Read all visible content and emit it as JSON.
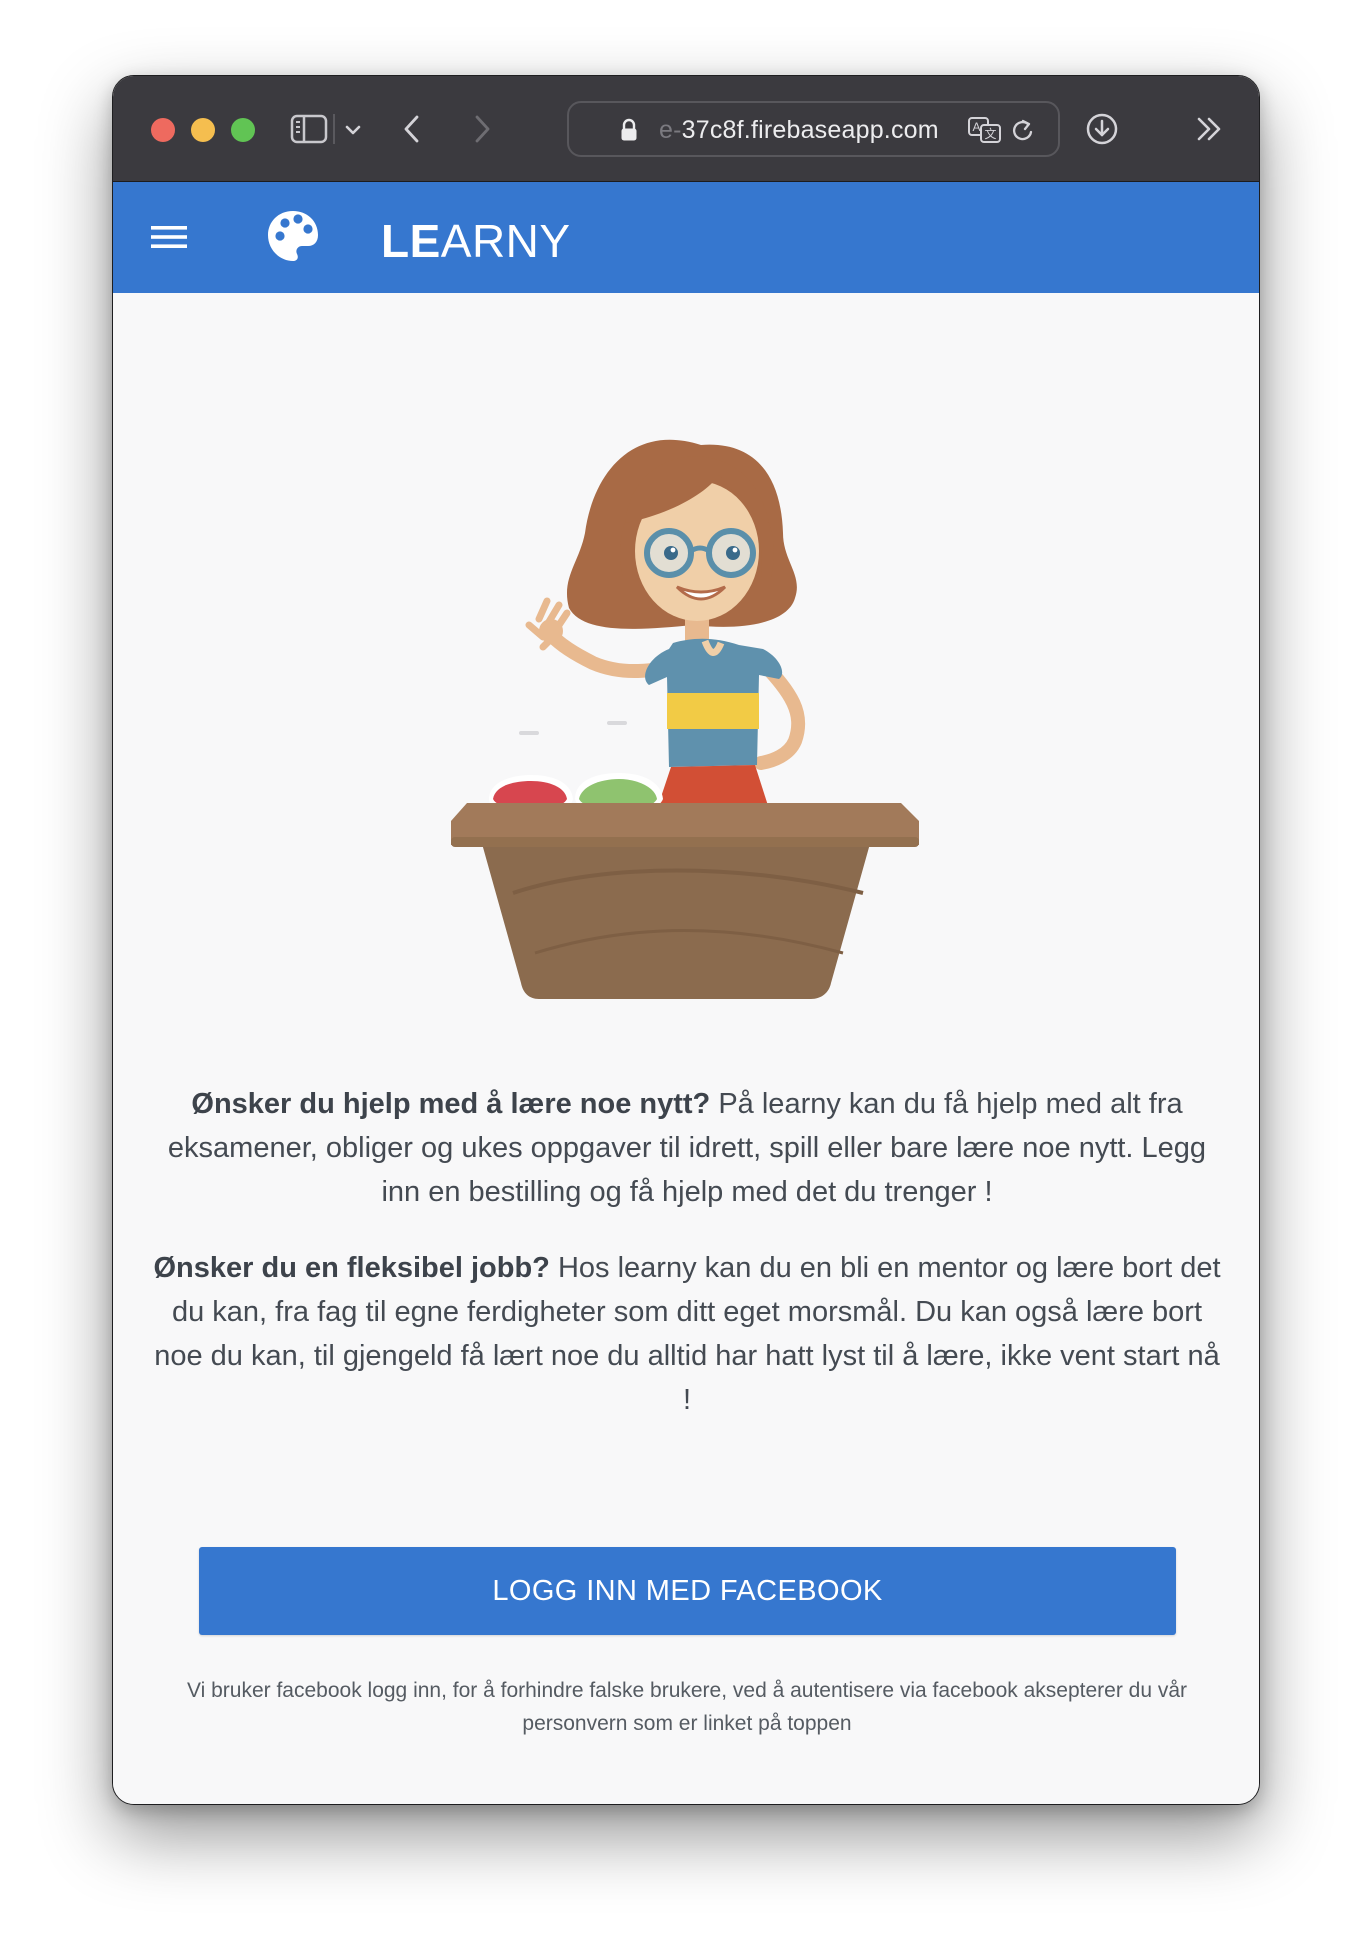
{
  "browser": {
    "url_prefix_faded": "e-",
    "url_domain": "37c8f.firebaseapp.com",
    "icons": [
      "sidebar-icon",
      "chevron-down-icon",
      "back-icon",
      "forward-icon",
      "lock-icon",
      "translate-icon",
      "reload-icon",
      "download-icon",
      "more-icon"
    ]
  },
  "app": {
    "brand_bold": "LE",
    "brand_rest": "ARNY",
    "brand_icon": "palette-icon",
    "menu_icon": "hamburger-icon",
    "header_color": "#3677cf"
  },
  "content": {
    "intro1_bold": "Ønsker du hjelp med å lære noe nytt?",
    "intro1_text": " På learny kan du få hjelp med alt fra eksamener, obliger og ukes oppgaver til idrett, spill eller bare lære noe nytt. Legg inn en bestilling og få hjelp med det du trenger !",
    "intro2_bold": "Ønsker du en fleksibel jobb?",
    "intro2_text": " Hos learny kan du en bli en mentor og lære bort det du kan, fra fag til egne ferdigheter som ditt eget morsmål. Du kan også lære bort noe du kan, til gjengeld få lært noe du alltid har hatt lyst til å lære, ikke vent start nå !",
    "login_button": "LOGG INN MED FACEBOOK",
    "disclaimer": "Vi bruker facebook logg inn, for å forhindre falske brukere, ved å autentisere via facebook aksepterer du vår personvern som er linket på toppen"
  }
}
